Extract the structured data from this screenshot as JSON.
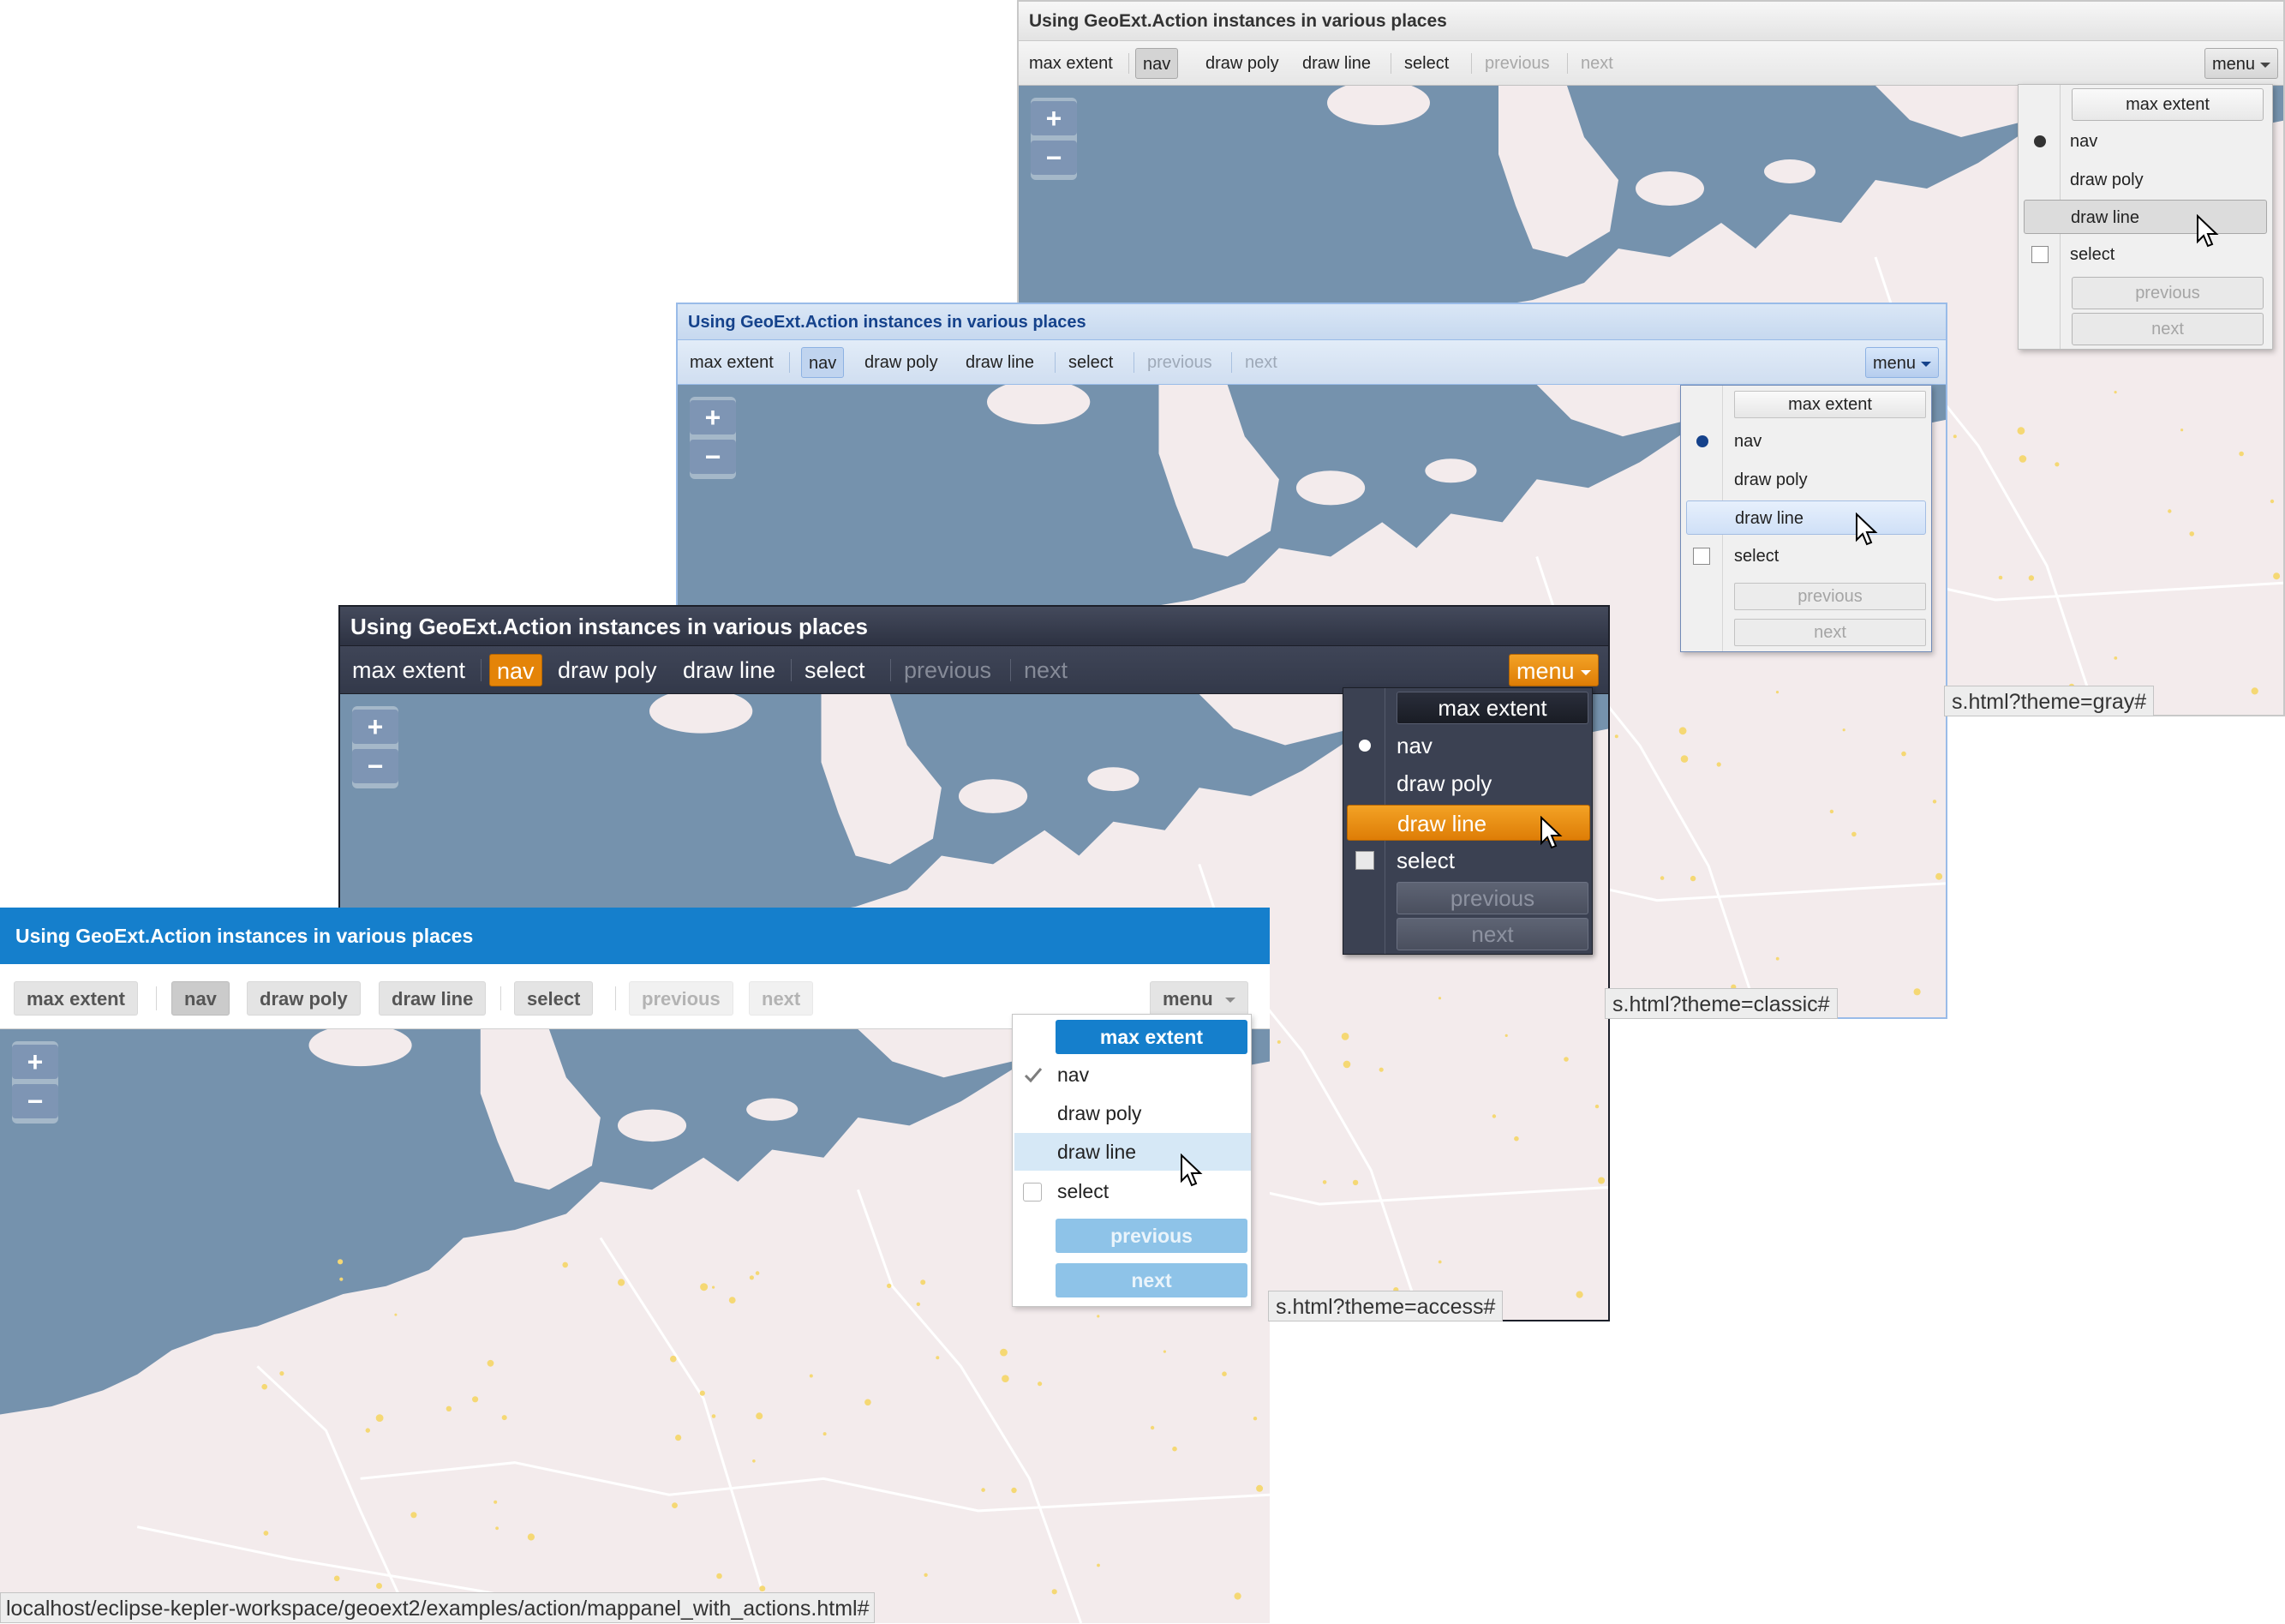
{
  "windows": {
    "gray": {
      "title": "Using GeoExt.Action instances in various places",
      "toolbar": {
        "max_extent": "max extent",
        "nav": "nav",
        "draw_poly": "draw poly",
        "draw_line": "draw line",
        "select": "select",
        "previous": "previous",
        "next": "next",
        "menu": "menu"
      },
      "menu": {
        "max_extent": "max extent",
        "nav": "nav",
        "draw_poly": "draw poly",
        "draw_line": "draw line",
        "select": "select",
        "previous": "previous",
        "next": "next"
      },
      "status_url": "s.html?theme=gray#"
    },
    "classic": {
      "title": "Using GeoExt.Action instances in various places",
      "toolbar": {
        "max_extent": "max extent",
        "nav": "nav",
        "draw_poly": "draw poly",
        "draw_line": "draw line",
        "select": "select",
        "previous": "previous",
        "next": "next",
        "menu": "menu"
      },
      "menu": {
        "max_extent": "max extent",
        "nav": "nav",
        "draw_poly": "draw poly",
        "draw_line": "draw line",
        "select": "select",
        "previous": "previous",
        "next": "next"
      },
      "status_url": "s.html?theme=classic#"
    },
    "access": {
      "title": "Using GeoExt.Action instances in various places",
      "toolbar": {
        "max_extent": "max extent",
        "nav": "nav",
        "draw_poly": "draw poly",
        "draw_line": "draw line",
        "select": "select",
        "previous": "previous",
        "next": "next",
        "menu": "menu"
      },
      "menu": {
        "max_extent": "max extent",
        "nav": "nav",
        "draw_poly": "draw poly",
        "draw_line": "draw line",
        "select": "select",
        "previous": "previous",
        "next": "next"
      },
      "status_url": "s.html?theme=access#"
    },
    "neptune": {
      "title": "Using GeoExt.Action instances in various places",
      "toolbar": {
        "max_extent": "max extent",
        "nav": "nav",
        "draw_poly": "draw poly",
        "draw_line": "draw line",
        "select": "select",
        "previous": "previous",
        "next": "next",
        "menu": "menu"
      },
      "menu": {
        "max_extent": "max extent",
        "nav": "nav",
        "draw_poly": "draw poly",
        "draw_line": "draw line",
        "select": "select",
        "previous": "previous",
        "next": "next"
      },
      "status_url": "localhost/eclipse-kepler-workspace/geoext2/examples/action/mappanel_with_actions.html#"
    }
  },
  "map": {
    "zoom_in": "+",
    "zoom_out": "−",
    "colors": {
      "sea": "#7592ad",
      "land": "#f3ebec",
      "border": "#ffffff",
      "city": "#f5d874"
    }
  },
  "icons": {
    "cursor": "arrow-cursor-icon",
    "radio": "radio-dot-icon",
    "checkbox": "checkbox-icon",
    "check": "checkmark-icon",
    "menu_arrow": "chevron-down-icon"
  }
}
